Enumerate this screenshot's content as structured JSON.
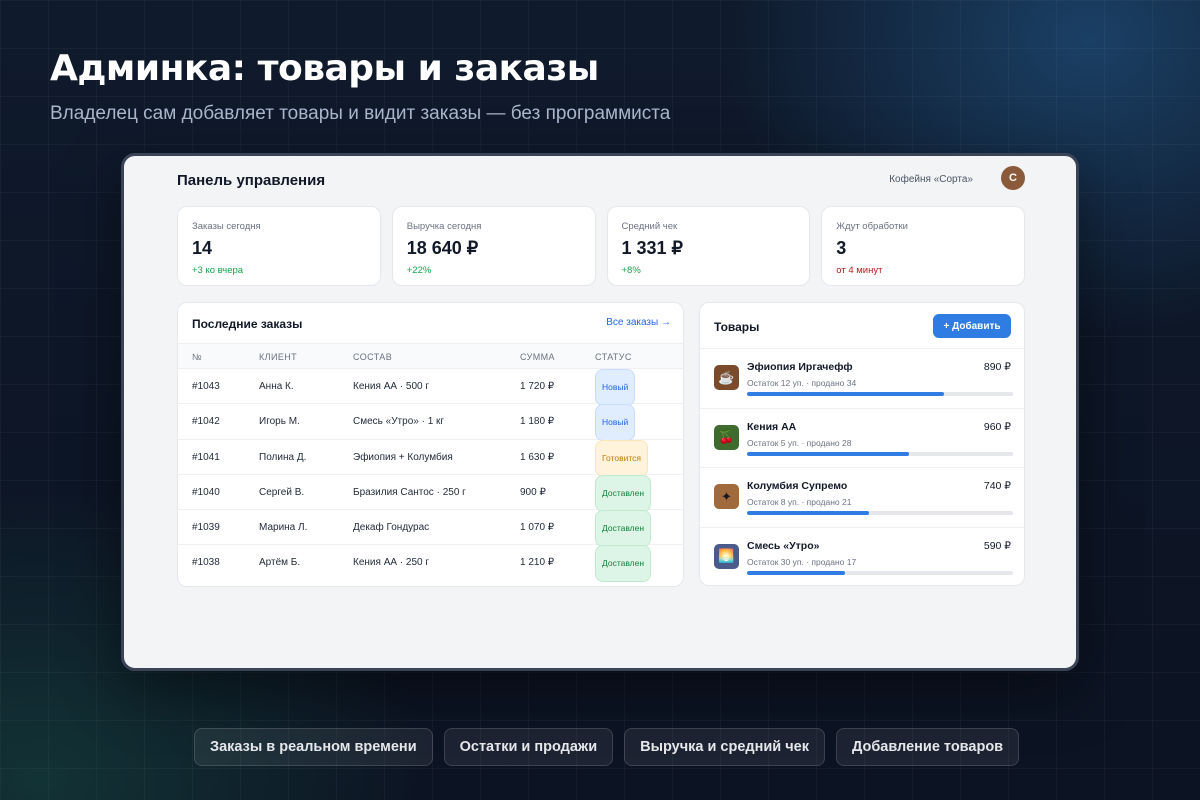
{
  "hero": {
    "title": "Админка: товары и заказы",
    "subtitle": "Владелец сам добавляет товары и видит заказы — без программиста"
  },
  "panel": {
    "title": "Панель управления",
    "shop_name": "Кофейня «Сорта»",
    "avatar_letter": "С"
  },
  "stats": [
    {
      "label": "Заказы сегодня",
      "value": "14",
      "delta": "+3 ко вчера",
      "delta_color": "#16a34a"
    },
    {
      "label": "Выручка сегодня",
      "value": "18 640 ₽",
      "delta": "+22%",
      "delta_color": "#16a34a"
    },
    {
      "label": "Средний чек",
      "value": "1 331 ₽",
      "delta": "+8%",
      "delta_color": "#16a34a"
    },
    {
      "label": "Ждут обработки",
      "value": "3",
      "delta": "от 4 минут",
      "delta_color": "#b91c1c"
    }
  ],
  "orders": {
    "title": "Последние заказы",
    "all_link": "Все заказы →",
    "columns": [
      "№",
      "КЛИЕНТ",
      "СОСТАВ",
      "СУММА",
      "СТАТУС"
    ],
    "rows": [
      {
        "id": "#1043",
        "client": "Анна К.",
        "items": "Кения АА · 500 г",
        "sum": "1 720 ₽",
        "status": "Новый",
        "status_kind": "new"
      },
      {
        "id": "#1042",
        "client": "Игорь М.",
        "items": "Смесь «Утро» · 1 кг",
        "sum": "1 180 ₽",
        "status": "Новый",
        "status_kind": "new"
      },
      {
        "id": "#1041",
        "client": "Полина Д.",
        "items": "Эфиопия + Колумбия",
        "sum": "1 630 ₽",
        "status": "Готовится",
        "status_kind": "cook"
      },
      {
        "id": "#1040",
        "client": "Сергей В.",
        "items": "Бразилия Сантос · 250 г",
        "sum": "900 ₽",
        "status": "Доставлен",
        "status_kind": "done"
      },
      {
        "id": "#1039",
        "client": "Марина Л.",
        "items": "Декаф Гондурас",
        "sum": "1 070 ₽",
        "status": "Доставлен",
        "status_kind": "done"
      },
      {
        "id": "#1038",
        "client": "Артём Б.",
        "items": "Кения АА · 250 г",
        "sum": "1 210 ₽",
        "status": "Доставлен",
        "status_kind": "done"
      }
    ]
  },
  "goods": {
    "title": "Товары",
    "add_label": "+ Добавить",
    "items": [
      {
        "name": "Эфиопия Иргачефф",
        "meta": "Остаток 12 уп. · продано 34",
        "price": "890 ₽",
        "sales_fill": 0.74,
        "icon": "coffee-cup-icon",
        "glyph": "☕",
        "icon_bg": "#7a4a2a"
      },
      {
        "name": "Кения АА",
        "meta": "Остаток 5 уп. · продано 28",
        "price": "960 ₽",
        "sales_fill": 0.61,
        "icon": "cherry-icon",
        "glyph": "🍒",
        "icon_bg": "#3f6b2f"
      },
      {
        "name": "Колумбия Супремо",
        "meta": "Остаток 8 уп. · продано 21",
        "price": "740 ₽",
        "sales_fill": 0.46,
        "icon": "coffee-beans-icon",
        "glyph": "✦",
        "icon_bg": "#a06a3c"
      },
      {
        "name": "Смесь «Утро»",
        "meta": "Остаток 30 уп. · продано 17",
        "price": "590 ₽",
        "sales_fill": 0.37,
        "icon": "sunrise-icon",
        "glyph": "🌅",
        "icon_bg": "#4a5a8a"
      }
    ]
  },
  "chips": [
    "Заказы в реальном времени",
    "Остатки и продажи",
    "Выручка и средний чек",
    "Добавление товаров"
  ]
}
